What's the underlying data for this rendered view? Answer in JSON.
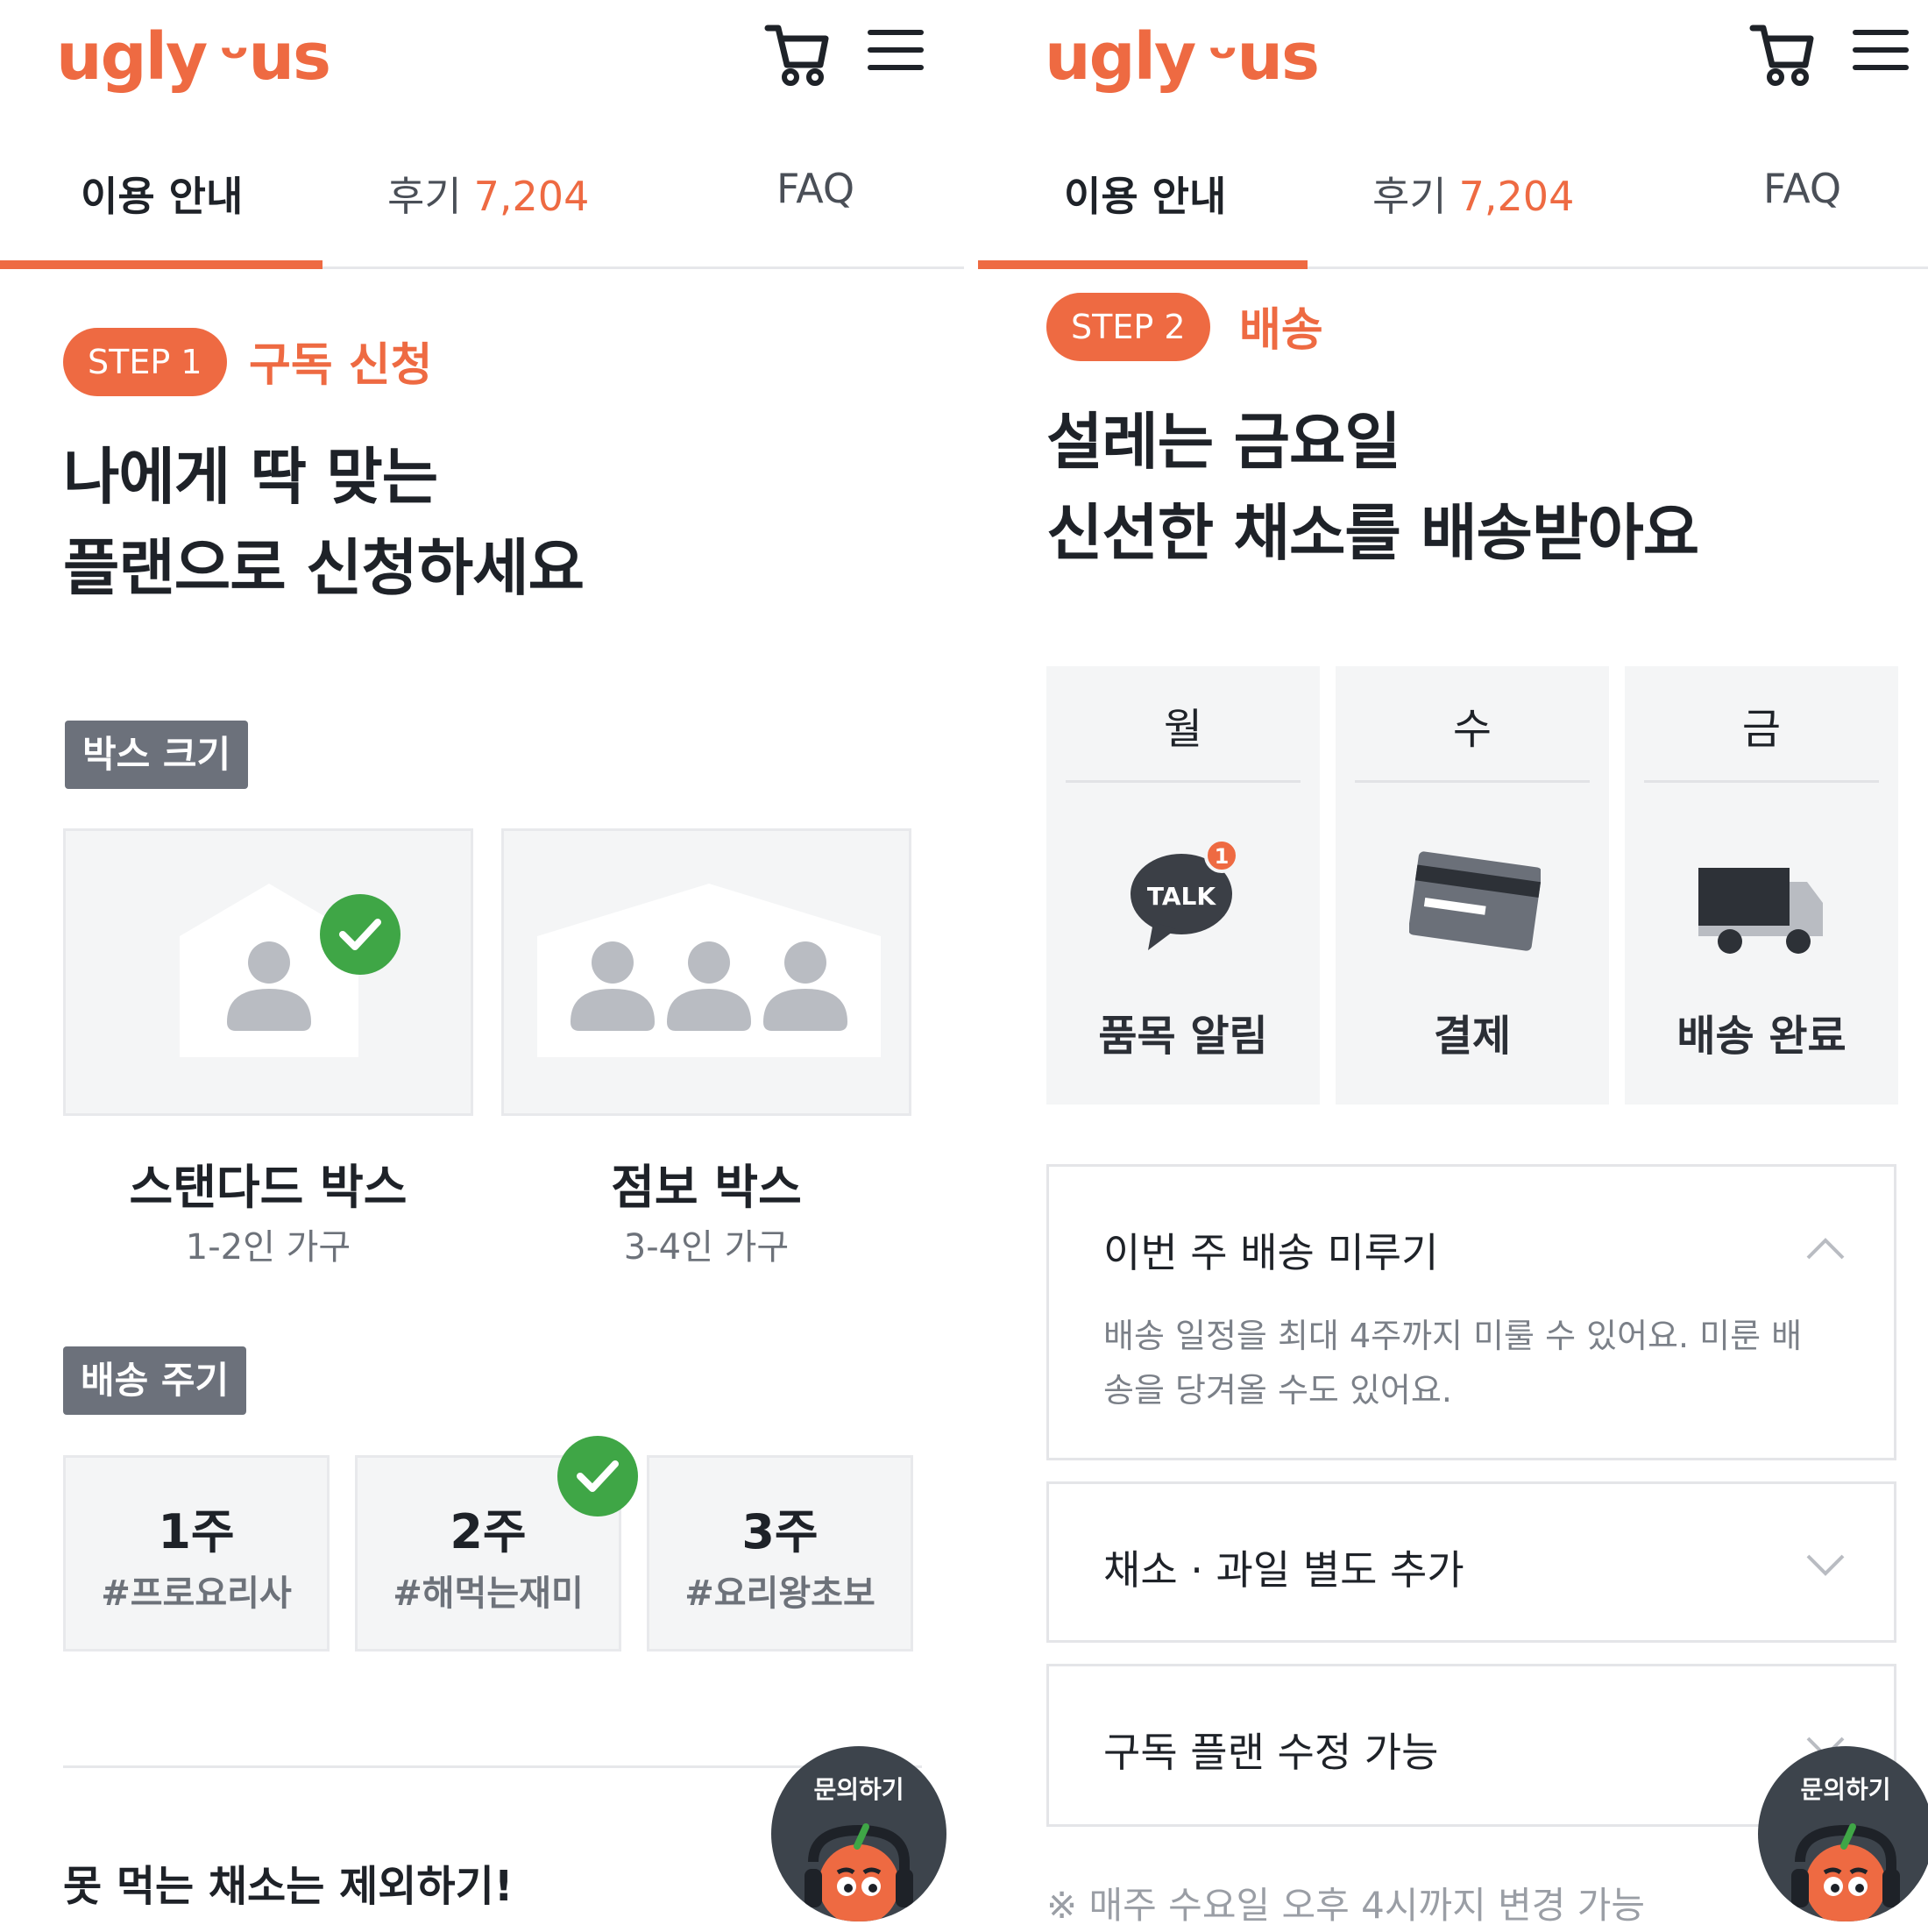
{
  "header": {
    "logo_text": "ugly",
    "logo_suffix": "us"
  },
  "tabs": {
    "guide": "이용 안내",
    "reviews": "후기",
    "reviews_count": "7,204",
    "faq": "FAQ"
  },
  "left": {
    "step_label": "STEP 1",
    "step_title": "구독 신청",
    "headline_1": "나에게 딱 맞는",
    "headline_2": "플랜으로 신청하세요",
    "box_tag": "박스 크기",
    "boxes": [
      {
        "name": "스탠다드 박스",
        "desc": "1-2인 가구",
        "selected": true
      },
      {
        "name": "점보 박스",
        "desc": "3-4인 가구",
        "selected": false
      }
    ],
    "cycle_tag": "배송 주기",
    "cycles": [
      {
        "week": "1주",
        "tag": "#프로요리사",
        "selected": false
      },
      {
        "week": "2주",
        "tag": "#해먹는재미",
        "selected": true
      },
      {
        "week": "3주",
        "tag": "#요리왕초보",
        "selected": false
      }
    ],
    "bottom_text": "못 먹는 채소는 제외하기!"
  },
  "right": {
    "step_label": "STEP 2",
    "step_title": "배송",
    "headline_1": "설레는 금요일",
    "headline_2": "신선한 채소를 배송받아요",
    "schedule": [
      {
        "day": "월",
        "label": "품목 알림",
        "icon": "talk-icon"
      },
      {
        "day": "수",
        "label": "결제",
        "icon": "credit-card-icon"
      },
      {
        "day": "금",
        "label": "배송 완료",
        "icon": "truck-icon"
      }
    ],
    "talk_badge": "1",
    "talk_text": "TALK",
    "accordion": [
      {
        "title": "이번 주 배송 미루기",
        "body": "배송 일정을 최대 4주까지 미룰 수 있어요. 미룬 배송을 당겨올 수도 있어요.",
        "expanded": true
      },
      {
        "title": "채소 · 과일 별도 추가",
        "expanded": false
      },
      {
        "title": "구독 플랜 수정 가능",
        "expanded": false
      }
    ],
    "note": "※ 매주 수요일 오후 4시까지 변경 가능"
  },
  "help": {
    "label": "문의하기"
  },
  "colors": {
    "accent": "#ee6a42",
    "check": "#3fa646",
    "tag_bg": "#6c717b",
    "card_bg": "#f4f5f6"
  }
}
